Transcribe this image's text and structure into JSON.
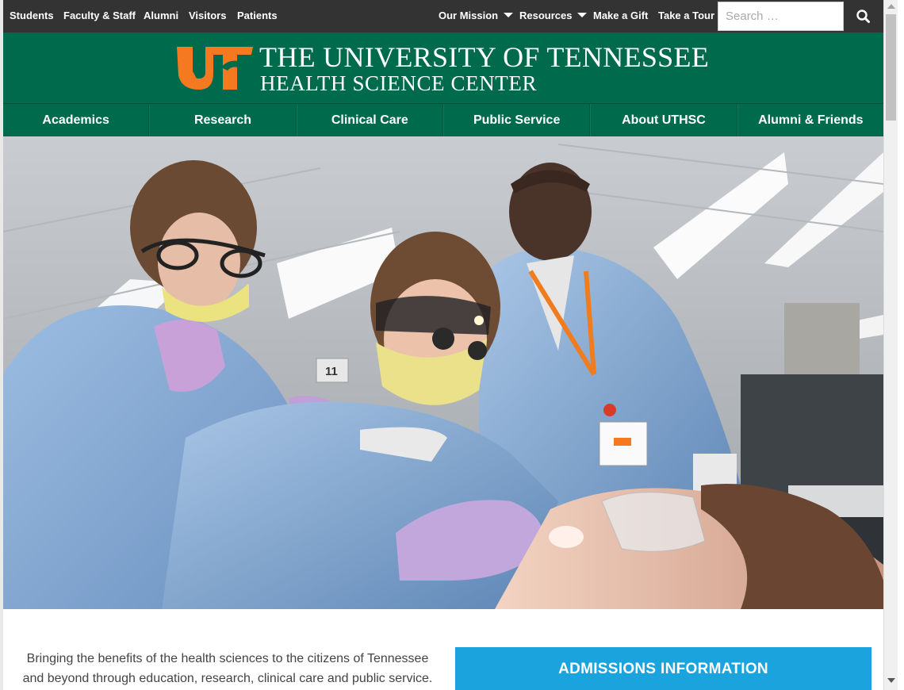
{
  "utility_nav": {
    "left": [
      "Students",
      "Faculty & Staff",
      "Alumni",
      "Visitors",
      "Patients"
    ],
    "right": [
      "Our Mission",
      "Resources",
      "Make a Gift",
      "Take a Tour"
    ]
  },
  "search": {
    "placeholder": "Search …"
  },
  "header": {
    "title_line1": "THE UNIVERSITY OF TENNESSEE",
    "title_line2": "HEALTH SCIENCE CENTER"
  },
  "main_nav": [
    "Academics",
    "Research",
    "Clinical Care",
    "Public Service",
    "About UTHSC",
    "Alumni & Friends"
  ],
  "hero": {
    "room_number": "11"
  },
  "content": {
    "mission_line1": "Bringing the benefits of the health sciences to the citizens of Tennessee",
    "mission_line2": "and beyond through education, research, clinical care and public service.",
    "admissions_label": "ADMISSIONS INFORMATION"
  },
  "colors": {
    "topbar": "#333333",
    "brand_green": "#006a4d",
    "logo_orange": "#f47920",
    "admissions_blue": "#1aa3dd"
  },
  "icons": [
    "search-icon",
    "chevron-down-icon",
    "ut-logo"
  ]
}
